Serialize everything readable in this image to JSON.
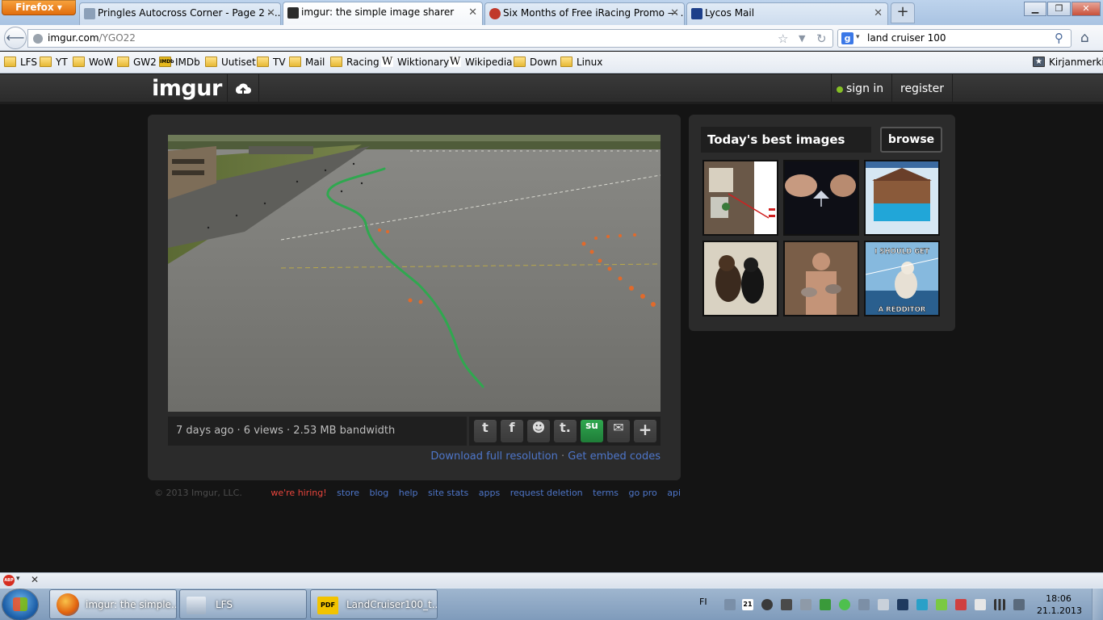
{
  "browser": {
    "menu_label": "Firefox",
    "tabs": [
      {
        "label": "Pringles Autocross Corner - Page 2 - ...",
        "active": false
      },
      {
        "label": "imgur: the simple image sharer",
        "active": true
      },
      {
        "label": "Six Months of Free iRacing Promo — ...",
        "active": false
      },
      {
        "label": "Lycos Mail",
        "active": false
      }
    ],
    "new_tab_label": "+",
    "url_host": "imgur.com",
    "url_path": "/YGO22",
    "search_engine_icon": "google-icon",
    "search_value": "land cruiser 100",
    "bookmarks": [
      {
        "label": "LFS",
        "icon": "folder-icon"
      },
      {
        "label": "YT",
        "icon": "folder-icon"
      },
      {
        "label": "WoW",
        "icon": "folder-icon"
      },
      {
        "label": "GW2",
        "icon": "folder-icon"
      },
      {
        "label": "IMDb",
        "icon": "imdb-icon"
      },
      {
        "label": "Uutiset",
        "icon": "folder-icon"
      },
      {
        "label": "TV",
        "icon": "folder-icon"
      },
      {
        "label": "Mail",
        "icon": "folder-icon"
      },
      {
        "label": "Racing",
        "icon": "folder-icon"
      },
      {
        "label": "Wiktionary",
        "icon": "wikipedia-icon"
      },
      {
        "label": "Wikipedia",
        "icon": "wikipedia-icon"
      },
      {
        "label": "Down",
        "icon": "folder-icon"
      },
      {
        "label": "Linux",
        "icon": "folder-icon"
      }
    ],
    "bookmarks_menu_label": "Kirjanmerkit"
  },
  "imgur": {
    "logo": "imgur",
    "sign_in": "sign in",
    "register": "register",
    "stats": "7 days ago · 6 views · 2.53 MB bandwidth",
    "share_icons": [
      "twitter-icon",
      "facebook-icon",
      "reddit-icon",
      "tumblr-icon",
      "stumbleupon-icon",
      "email-icon",
      "plus-icon"
    ],
    "download_link": "Download full resolution",
    "embed_link": "Get embed codes",
    "link_separator": "·",
    "side_title": "Today's best images",
    "browse_label": "browse",
    "thumb_captions": {
      "top": "I SHOULD GET",
      "bottom": "A REDDITOR"
    },
    "footer": {
      "copyright": "© 2013 Imgur, LLC.",
      "links": [
        "we're hiring!",
        "store",
        "blog",
        "help",
        "site stats",
        "apps",
        "request deletion",
        "terms",
        "go pro",
        "api"
      ]
    }
  },
  "taskbar": {
    "items": [
      {
        "label": "imgur: the simple...",
        "active": true
      },
      {
        "label": "LFS",
        "active": false
      },
      {
        "label": "LandCruiser100_t...",
        "active": false
      }
    ],
    "language": "FI",
    "time": "18:06",
    "date": "21.1.2013",
    "calendar_day": "21"
  },
  "colors": {
    "accent_blue": "#4e76c9",
    "hiring_red": "#e8453c",
    "online_green": "#85bf25",
    "path_green": "#2fa84f"
  }
}
